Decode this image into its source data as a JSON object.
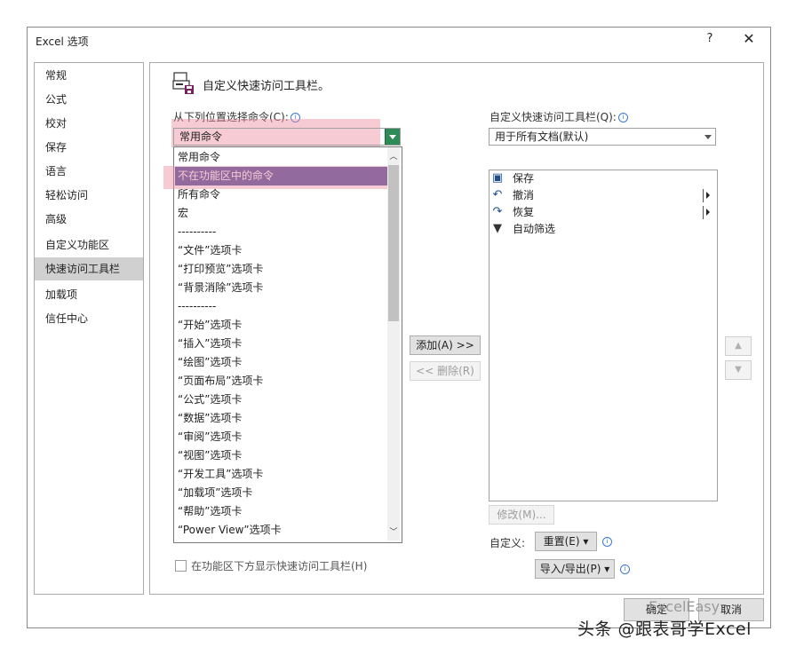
{
  "window": {
    "title": "Excel 选项",
    "help": "?",
    "close": "✕"
  },
  "nav": {
    "items": [
      "常规",
      "公式",
      "校对",
      "保存",
      "语言",
      "轻松访问",
      "高级",
      "自定义功能区",
      "快速访问工具栏",
      "加载项",
      "信任中心"
    ],
    "active_index": 8
  },
  "main": {
    "section_title": "自定义快速访问工具栏。",
    "choose_from_label": "从下列位置选择命令(C):",
    "choose_from_value": "常用命令",
    "qat_scope_label": "自定义快速访问工具栏(Q):",
    "qat_scope_value": "用于所有文档(默认)",
    "dropdown_options": [
      "常用命令",
      "不在功能区中的命令",
      "所有命令",
      "宏",
      "----------",
      "“文件”选项卡",
      "“打印预览”选项卡",
      "“背景消除”选项卡",
      "----------",
      "“开始”选项卡",
      "“插入”选项卡",
      "“绘图”选项卡",
      "“页面布局”选项卡",
      "“公式”选项卡",
      "“数据”选项卡",
      "“审阅”选项卡",
      "“视图”选项卡",
      "“开发工具”选项卡",
      "“加载项”选项卡",
      "“帮助”选项卡",
      "“Power View”选项卡"
    ],
    "dropdown_selected_index": 1,
    "add_button": "添加(A) >>",
    "remove_button": "<< 删除(R)",
    "qat_items": [
      {
        "icon": "save-icon",
        "glyph": "▣",
        "label": "保存",
        "submenu": false
      },
      {
        "icon": "undo-icon",
        "glyph": "↶",
        "label": "撤消",
        "submenu": true
      },
      {
        "icon": "redo-icon",
        "glyph": "↷",
        "label": "恢复",
        "submenu": true
      },
      {
        "icon": "filter-icon",
        "glyph": "▼",
        "label": "自动筛选",
        "submenu": false
      }
    ],
    "modify_button": "修改(M)...",
    "customize_label": "自定义:",
    "reset_button": "重置(E) ▾",
    "import_export_button": "导入/导出(P) ▾",
    "show_below_ribbon_label": "在功能区下方显示快速访问工具栏(H)",
    "move_up": "▲",
    "move_down": "▼"
  },
  "footer": {
    "ok_button": "确定",
    "cancel_button": "取消"
  },
  "watermark": {
    "text": "头条 @跟表哥学Excel",
    "faint_text": "ExcelEasy"
  },
  "colors": {
    "selected_option": "#4a4f9c",
    "highlight": "#ec8ca0",
    "dropdown_arrow": "#2e8b57",
    "active_nav": "#d0d0d0"
  }
}
